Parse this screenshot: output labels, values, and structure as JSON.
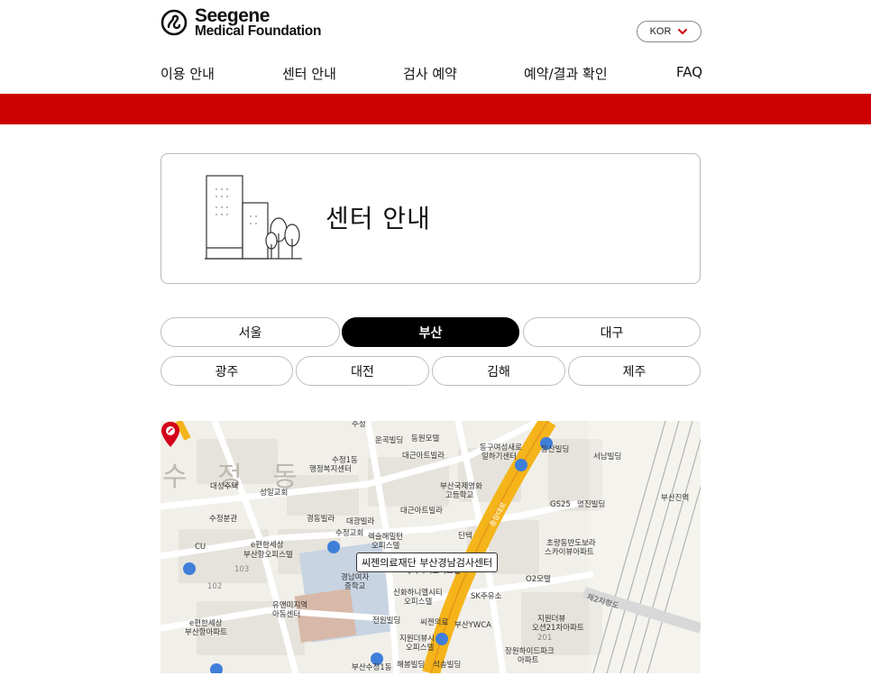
{
  "header": {
    "logo_line1": "Seegene",
    "logo_line2": "Medical Foundation",
    "lang_label": "KOR"
  },
  "nav": {
    "items": [
      "이용 안내",
      "센터 안내",
      "검사 예약",
      "예약/결과 확인",
      "FAQ"
    ]
  },
  "colors": {
    "brand_red": "#cc0000",
    "active_tab": "#000000"
  },
  "title_card": {
    "title": "센터 안내"
  },
  "regions": {
    "row1": [
      "서울",
      "부산",
      "대구"
    ],
    "row2": [
      "광주",
      "대전",
      "김해",
      "제주"
    ],
    "active": "부산"
  },
  "map": {
    "marker_label": "씨젠의료재단 부산경남검사센터",
    "district": "수 정 동",
    "labels": [
      "수정",
      "운곡빌딩",
      "동원모텔",
      "대근아트빌라",
      "동구여성새로",
      "일하기센터",
      "동산빌딩",
      "서남빌딩",
      "수정1동",
      "행정복지센터",
      "대성주택",
      "성일교회",
      "부산국제영화",
      "고등학교",
      "GS25",
      "명진빌딩",
      "부산진역",
      "수정분관",
      "경동빌라",
      "대광빌라",
      "대근아트빌라",
      "수정교회",
      "렉슬해밀턴",
      "오피스텔",
      "딘텍",
      "초량동반도보라",
      "스카이뷰아파트",
      "e편한세상",
      "부산항오피스텔",
      "베이시티오피스텔",
      "경남여자",
      "중학교",
      "O2모텔",
      "신화하니엘시티",
      "오피스텔",
      "SK주유소",
      "유앤미지역",
      "아동센터",
      "전원빌딩",
      "씨젠의료",
      "부산YWCA",
      "지원더뷰",
      "오션21차아파트",
      "e편한세상",
      "부산항아파트",
      "지원더뷰시",
      "오피스텔",
      "장원하이드파크",
      "아파트",
      "부산수정1동",
      "해봉빌딩",
      "석송빌딩",
      "충장대로",
      "제2차항도",
      "103",
      "102",
      "CU",
      "201"
    ]
  }
}
